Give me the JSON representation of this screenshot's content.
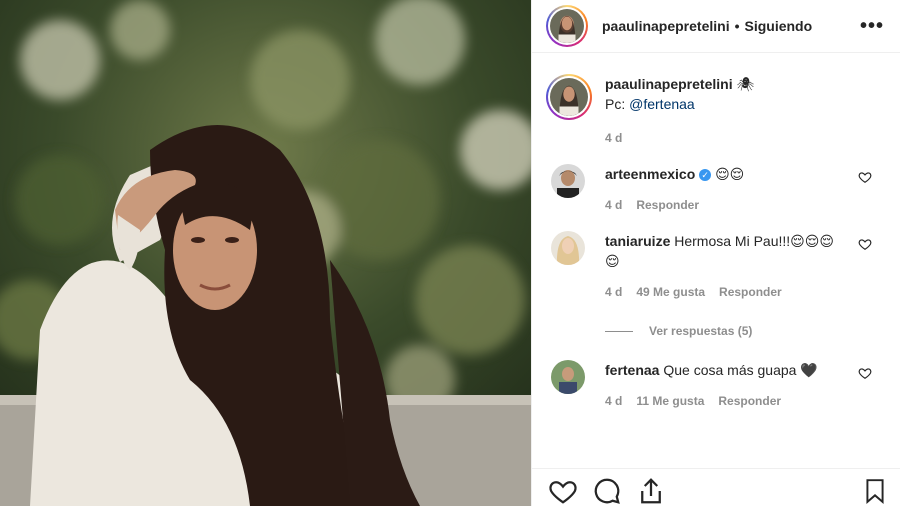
{
  "header": {
    "username": "paaulinapepretelini",
    "separator": "•",
    "follow_status": "Siguiendo",
    "more": "•••"
  },
  "caption": {
    "username": "paaulinapepretelini",
    "emoji": "🕷",
    "text_prefix": "Pc: ",
    "mention": "@fertenaa",
    "time": "4 d"
  },
  "comments": [
    {
      "username": "arteenmexico",
      "verified": true,
      "text": "😌😌",
      "time": "4 d",
      "reply": "Responder"
    },
    {
      "username": "taniaruize",
      "text": "Hermosa Mi Pau!!!😌😌😌😌",
      "time": "4 d",
      "likes": "49 Me gusta",
      "reply": "Responder"
    },
    {
      "username": "fertenaa",
      "text": "Que cosa más guapa 🖤",
      "time": "4 d",
      "likes": "11 Me gusta",
      "reply": "Responder"
    }
  ],
  "view_replies": "Ver respuestas (5)",
  "colors": {
    "link": "#003569",
    "muted": "#8e8e8e",
    "verified": "#3897f0"
  },
  "icons": [
    "heart-icon",
    "comment-icon",
    "share-icon",
    "bookmark-icon",
    "spider-icon",
    "verified-icon"
  ]
}
